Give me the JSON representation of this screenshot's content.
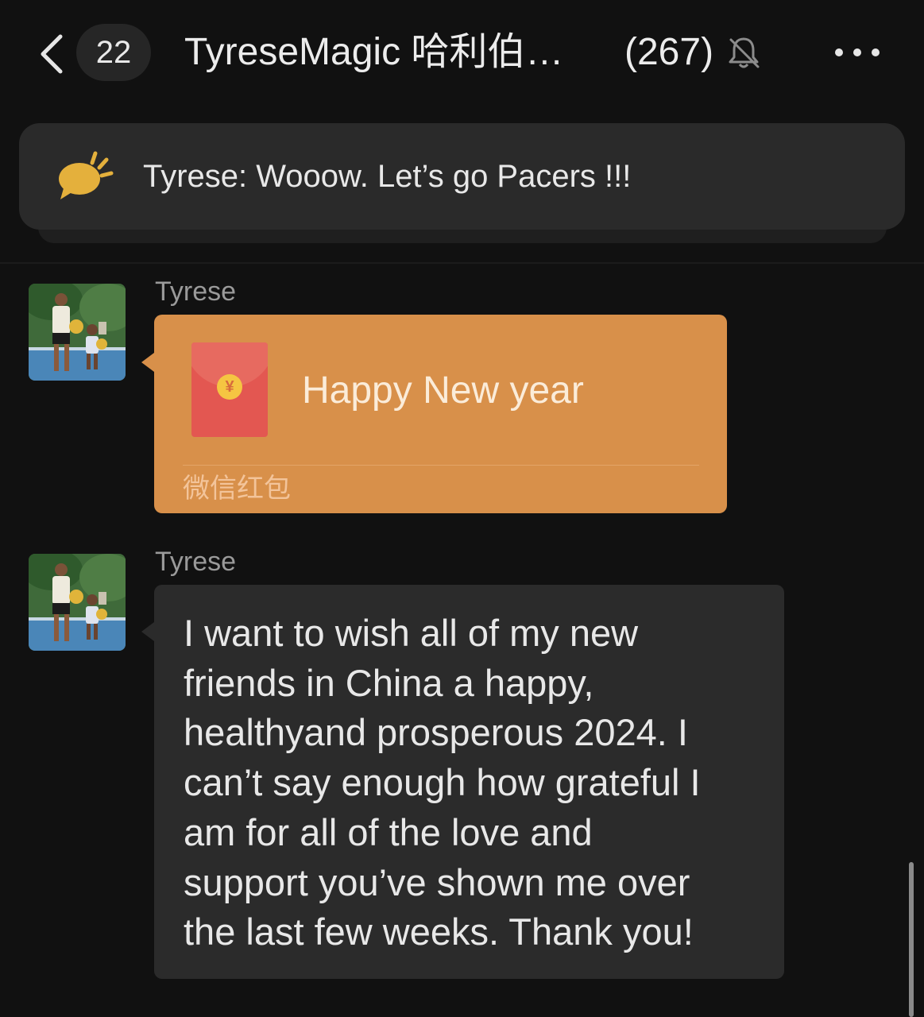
{
  "header": {
    "back_icon": "chevron-left-icon",
    "unread_count": "22",
    "title": "TyreseMagic 哈利伯…",
    "member_count": "(267)",
    "mute_icon": "bell-slash-icon",
    "more_icon": "ellipsis-icon"
  },
  "pinned": {
    "icon": "speech-bubble-icon",
    "text": "Tyrese: Wooow. Let’s go Pacers !!!"
  },
  "messages": [
    {
      "type": "red_packet",
      "sender": "Tyrese",
      "title": "Happy New year",
      "label": "微信红包",
      "currency_symbol": "¥"
    },
    {
      "type": "text",
      "sender": "Tyrese",
      "text": " I want to wish all of my new\nfriends in China a happy,\nhealthyand prosperous 2024.  I\ncan’t say enough how grateful I\nam for all of the love and\nsupport you’ve shown me over\nthe last few weeks. Thank you!"
    }
  ],
  "colors": {
    "background": "#111111",
    "bubble": "#2b2b2b",
    "red_packet": "#d8904a",
    "envelope": "#e35751",
    "pin_icon": "#e4b03c"
  }
}
